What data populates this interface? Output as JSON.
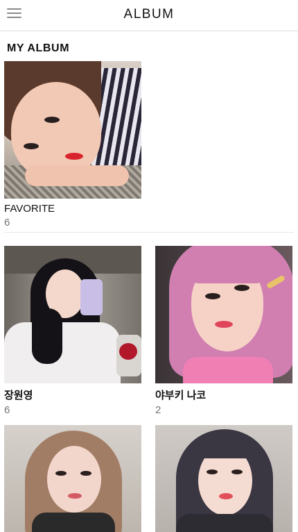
{
  "header": {
    "title": "ALBUM",
    "menu_icon": "hamburger-menu-icon"
  },
  "section": {
    "title": "MY ALBUM"
  },
  "albums": [
    {
      "name": "FAVORITE",
      "count": "6"
    },
    {
      "name": "장원영",
      "count": "6"
    },
    {
      "name": "야부키 나코",
      "count": "2"
    },
    {
      "name": "",
      "count": ""
    },
    {
      "name": "",
      "count": ""
    }
  ],
  "colors": {
    "background": "#ffffff",
    "header_border": "#dcdcdc",
    "divider": "#e6e6e6",
    "count_text": "#777777",
    "menu_icon": "#8a8a8a"
  }
}
